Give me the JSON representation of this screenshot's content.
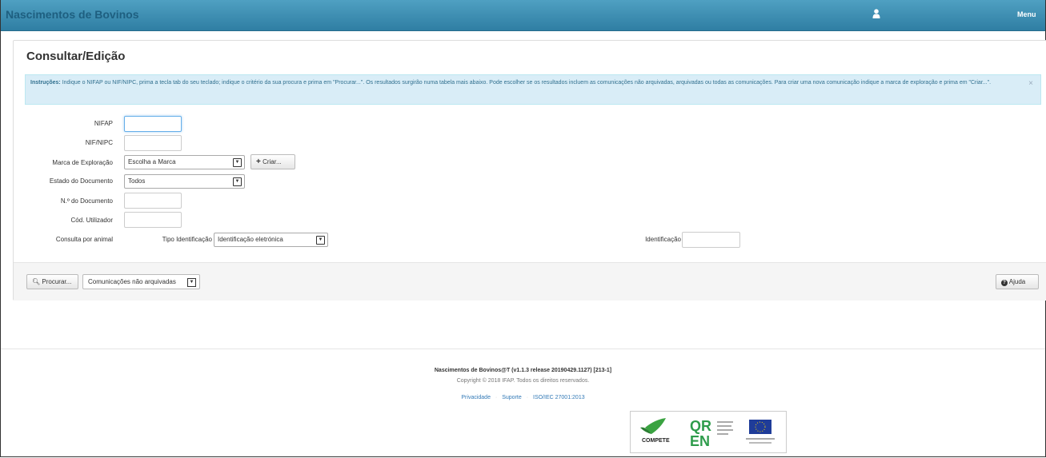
{
  "header": {
    "app_title": "Nascimentos de Bovinos",
    "menu_label": "Menu"
  },
  "page": {
    "title": "Consultar/Edição"
  },
  "alert": {
    "label": "Instruções:",
    "text": "Indique o NIFAP ou NIF/NIPC, prima a tecla tab do seu teclado; indique o critério da sua procura e prima em \"Procurar...\". Os resultados surgirão numa tabela mais abaixo. Pode escolher se os resultados incluem as comunicações não arquivadas, arquivadas ou todas as comunicações. Para criar uma nova comunicação indique a marca de exploração e prima em \"Criar...\".",
    "close": "×"
  },
  "form": {
    "nifap_label": "NIFAP",
    "nif_label": "NIF/NIPC",
    "marca_label": "Marca de Exploração",
    "marca_value": "Escolha a Marca",
    "criar_label": "Criar...",
    "estado_label": "Estado do Documento",
    "estado_value": "Todos",
    "ndoc_label": "N.º do Documento",
    "cod_label": "Cód. Utilizador",
    "consulta_label": "Consulta por animal",
    "tipo_label": "Tipo Identificação",
    "tipo_value": "Identificação eletrónica",
    "ident_label": "Identificação"
  },
  "actions": {
    "procurar_label": "Procurar...",
    "filter_value": "Comunicações não arquivadas",
    "ajuda_label": "Ajuda"
  },
  "footer": {
    "title": "Nascimentos de Bovinos@T (v1.1.3 release 20190429.1127) [213-1]",
    "copyright": "Copyright © 2018 IFAP. Todos os direitos reservados.",
    "links": [
      "Privacidade",
      "Suporte",
      "ISO/IEC 27001:2013"
    ],
    "logo_compete": "COMPETE"
  }
}
